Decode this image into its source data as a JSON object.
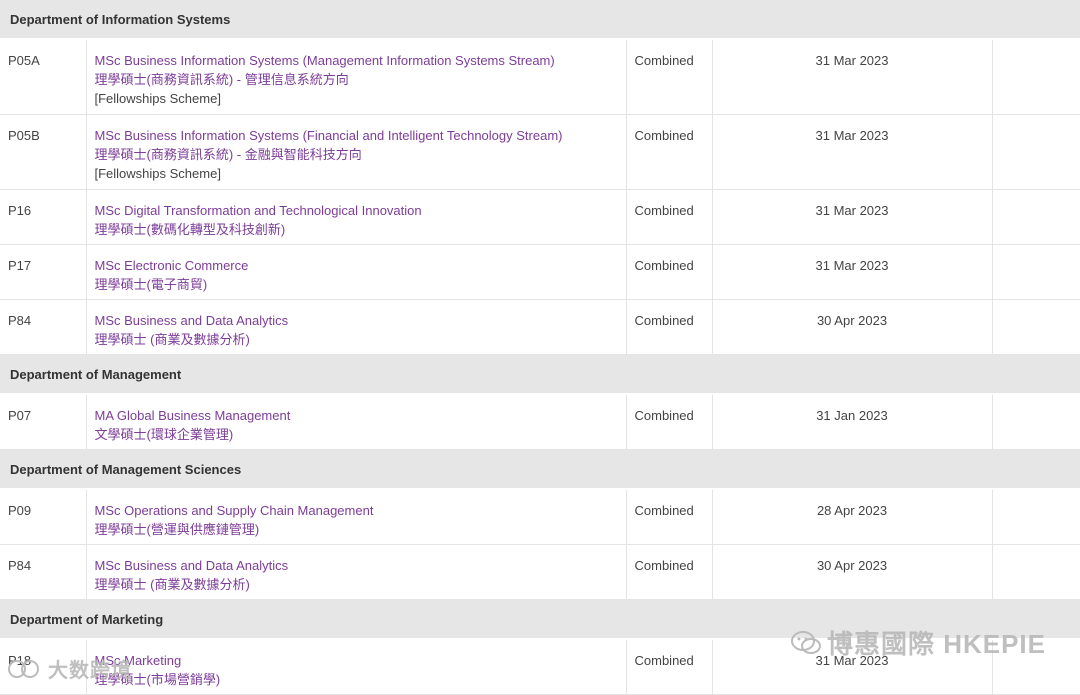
{
  "sections": [
    {
      "department": "Department of Information Systems",
      "rows": [
        {
          "code": "P05A",
          "en": "MSc Business Information Systems (Management Information Systems Stream)",
          "zh": "理學碩士(商務資訊系統) - 管理信息系統方向",
          "note": "[Fellowships Scheme]",
          "mode": "Combined",
          "deadline": "31 Mar 2023"
        },
        {
          "code": "P05B",
          "en": "MSc Business Information Systems (Financial and Intelligent Technology Stream)",
          "zh": "理學碩士(商務資訊系統) - 金融與智能科技方向",
          "note": "[Fellowships Scheme]",
          "mode": "Combined",
          "deadline": "31 Mar 2023"
        },
        {
          "code": "P16",
          "en": "MSc Digital Transformation and Technological Innovation",
          "zh": "理學碩士(數碼化轉型及科技創新)",
          "note": "",
          "mode": "Combined",
          "deadline": "31 Mar 2023"
        },
        {
          "code": "P17",
          "en": "MSc Electronic Commerce",
          "zh": "理學碩士(電子商貿)",
          "note": "",
          "mode": "Combined",
          "deadline": "31 Mar 2023"
        },
        {
          "code": "P84",
          "en": "MSc Business and Data Analytics",
          "zh": "理學碩士 (商業及數據分析)",
          "note": "",
          "mode": "Combined",
          "deadline": "30 Apr 2023"
        }
      ]
    },
    {
      "department": "Department of Management",
      "rows": [
        {
          "code": "P07",
          "en": "MA Global Business Management",
          "zh": "文學碩士(環球企業管理)",
          "note": "",
          "mode": "Combined",
          "deadline": "31 Jan 2023"
        }
      ]
    },
    {
      "department": "Department of Management Sciences",
      "rows": [
        {
          "code": "P09",
          "en": "MSc Operations and Supply Chain Management",
          "zh": "理學碩士(營運與供應鏈管理)",
          "note": "",
          "mode": "Combined",
          "deadline": "28 Apr 2023"
        },
        {
          "code": "P84",
          "en": "MSc Business and Data Analytics",
          "zh": "理學碩士 (商業及數據分析)",
          "note": "",
          "mode": "Combined",
          "deadline": "30 Apr 2023"
        }
      ]
    },
    {
      "department": "Department of Marketing",
      "rows": [
        {
          "code": "P18",
          "en": "MSc Marketing",
          "zh": "理學碩士(市場營銷學)",
          "note": "",
          "mode": "Combined",
          "deadline": "31 Mar 2023"
        }
      ]
    }
  ],
  "watermarks": {
    "right": "博惠國際 HKEPIE",
    "left": "大数跨境"
  },
  "colors": {
    "link": "#7d3c98",
    "header_bg": "#e6e6e6"
  }
}
